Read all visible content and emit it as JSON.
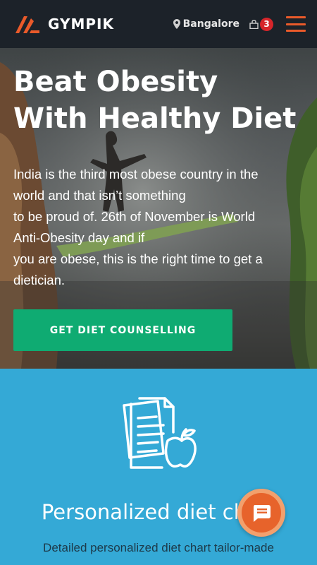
{
  "header": {
    "brand": "GYMPIK",
    "location": "Bangalore",
    "cart_count": "3",
    "logo_icon": "gympik-logo-icon",
    "location_icon": "map-pin-icon",
    "cart_icon": "shopping-bag-icon",
    "menu_icon": "hamburger-menu-icon",
    "accent_color": "#ea5a2a",
    "background_color": "#1c2229"
  },
  "hero": {
    "title_line1": "Beat Obesity",
    "title_line2": "With Healthy Diet",
    "text_lines": [
      "India is the third most obese country in the",
      "world and that isn’t something",
      "to be proud of. 26th of November is World",
      "Anti-Obesity day and if",
      "you are obese, this is the right time to get a",
      "dietician."
    ],
    "cta_label": "GET DIET COUNSELLING",
    "cta_color": "#0fab72"
  },
  "feature": {
    "icon": "diet-chart-apple-icon",
    "title": "Personalized diet chart",
    "subtitle": "Detailed personalized diet chart tailor-made",
    "background_color": "#34a9d6"
  },
  "chat": {
    "icon": "chat-bubble-icon",
    "color": "#e7632b"
  }
}
